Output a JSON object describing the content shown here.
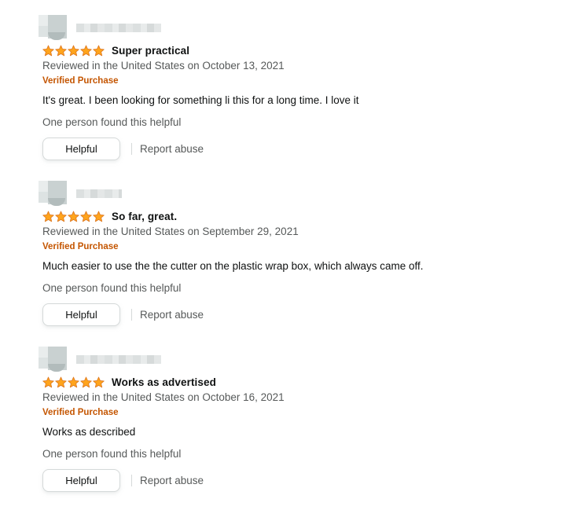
{
  "star_color": "#FFA41C",
  "star_stroke": "#DE7921",
  "verified_color": "#C45500",
  "reviews": [
    {
      "rating": 5,
      "title": "Super practical",
      "date": "Reviewed in the United States on October 13, 2021",
      "verified": "Verified Purchase",
      "body": "It's great. I been looking for something li this for a long time. I love it",
      "helpful_count": "One person found this helpful",
      "helpful_button": "Helpful",
      "report": "Report abuse"
    },
    {
      "rating": 5,
      "title": "So far, great.",
      "date": "Reviewed in the United States on September 29, 2021",
      "verified": "Verified Purchase",
      "body": "Much easier to use the the cutter on the plastic wrap box, which always came off.",
      "helpful_count": "One person found this helpful",
      "helpful_button": "Helpful",
      "report": "Report abuse"
    },
    {
      "rating": 5,
      "title": "Works as advertised",
      "date": "Reviewed in the United States on October 16, 2021",
      "verified": "Verified Purchase",
      "body": "Works as described",
      "helpful_count": "One person found this helpful",
      "helpful_button": "Helpful",
      "report": "Report abuse"
    }
  ]
}
